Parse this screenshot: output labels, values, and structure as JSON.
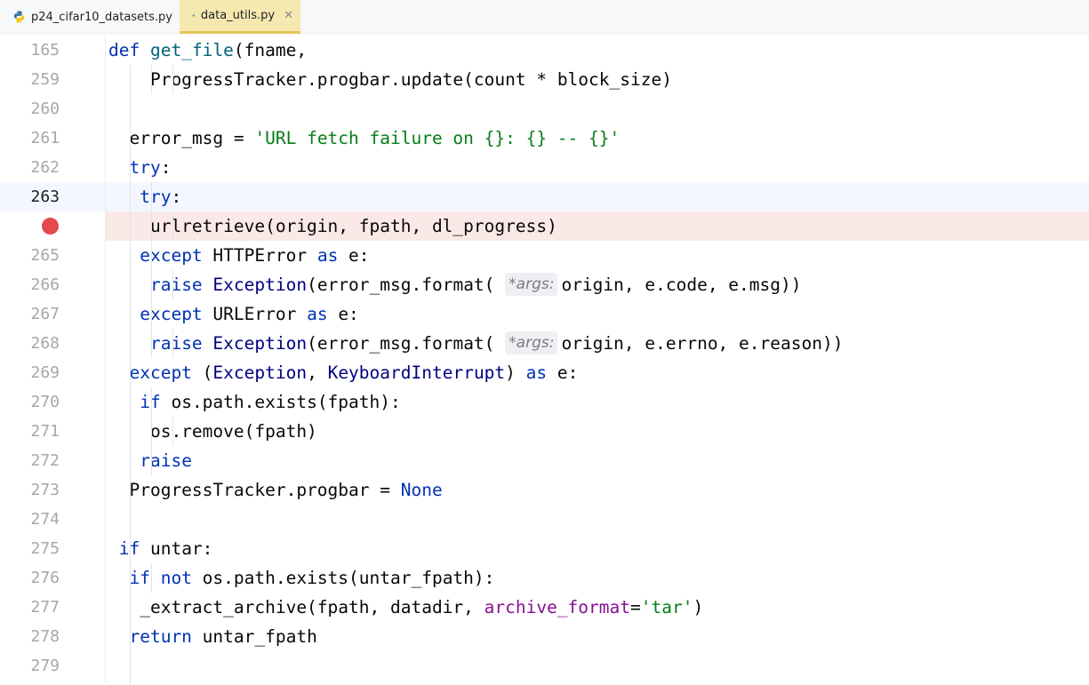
{
  "tabs": [
    {
      "label": "p24_cifar10_datasets.py",
      "icon": "python-file-icon",
      "active": false
    },
    {
      "label": "data_utils.py",
      "icon": "python-file-icon",
      "active": true
    }
  ],
  "close_glyph": "✕",
  "code_lines": [
    {
      "num": "165",
      "text": "def get_file(fname,"
    },
    {
      "num": "259",
      "text": "      ProgressTracker.progbar.update(count * block_size)"
    },
    {
      "num": "260",
      "text": ""
    },
    {
      "num": "261",
      "text": "    error_msg = 'URL fetch failure on {}: {} -- {}'"
    },
    {
      "num": "262",
      "text": "    try:"
    },
    {
      "num": "263",
      "text": "      try:"
    },
    {
      "num": "",
      "text": "        urlretrieve(origin, fpath, dl_progress)"
    },
    {
      "num": "265",
      "text": "      except HTTPError as e:"
    },
    {
      "num": "266",
      "text": "        raise Exception(error_msg.format( origin, e.code, e.msg))",
      "hint": "*args:"
    },
    {
      "num": "267",
      "text": "      except URLError as e:"
    },
    {
      "num": "268",
      "text": "        raise Exception(error_msg.format( origin, e.errno, e.reason))",
      "hint": "*args:"
    },
    {
      "num": "269",
      "text": "    except (Exception, KeyboardInterrupt) as e:"
    },
    {
      "num": "270",
      "text": "      if os.path.exists(fpath):"
    },
    {
      "num": "271",
      "text": "        os.remove(fpath)"
    },
    {
      "num": "272",
      "text": "      raise"
    },
    {
      "num": "273",
      "text": "    ProgressTracker.progbar = None"
    },
    {
      "num": "274",
      "text": ""
    },
    {
      "num": "275",
      "text": "  if untar:"
    },
    {
      "num": "276",
      "text": "    if not os.path.exists(untar_fpath):"
    },
    {
      "num": "277",
      "text": "      _extract_archive(fpath, datadir, archive_format='tar')"
    },
    {
      "num": "278",
      "text": "    return untar_fpath"
    },
    {
      "num": "279",
      "text": ""
    }
  ],
  "colors": {
    "keyword": "#0033b3",
    "function": "#00627a",
    "string": "#067d17",
    "named_param": "#871094",
    "breakpoint": "#e5484d",
    "breakpoint_line": "#fae9e6",
    "current_line": "#f4f7ff",
    "active_tab": "#f5e9b0"
  }
}
